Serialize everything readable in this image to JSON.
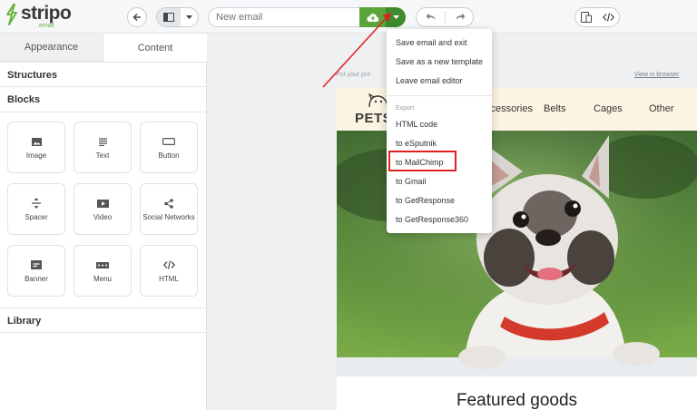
{
  "logo": {
    "word": "stripo",
    "sub": ".email"
  },
  "toolbar": {
    "email_name_placeholder": "New email",
    "icons": [
      "back-arrow-icon",
      "layout-icon",
      "caret-down-icon",
      "cloud-upload-icon",
      "undo-icon",
      "redo-icon",
      "mobile-view-icon",
      "code-icon"
    ]
  },
  "left_panel": {
    "tabs": [
      "Appearance",
      "Content"
    ],
    "active_tab": "Content",
    "sections": {
      "structures": "Structures",
      "blocks": "Blocks",
      "library": "Library"
    },
    "blocks": [
      {
        "label": "Image",
        "icon": "image-icon"
      },
      {
        "label": "Text",
        "icon": "text-icon"
      },
      {
        "label": "Button",
        "icon": "button-icon"
      },
      {
        "label": "Spacer",
        "icon": "spacer-icon"
      },
      {
        "label": "Video",
        "icon": "video-icon"
      },
      {
        "label": "Social Networks",
        "icon": "share-icon"
      },
      {
        "label": "Banner",
        "icon": "banner-icon"
      },
      {
        "label": "Menu",
        "icon": "menu-icon"
      },
      {
        "label": "HTML",
        "icon": "code-icon"
      }
    ]
  },
  "canvas": {
    "preheader": "Put your pre",
    "view_in_browser": "View in browser",
    "brand": "PETS",
    "nav": [
      "ccessories",
      "Belts",
      "Cages",
      "Other"
    ],
    "featured_heading": "Featured goods"
  },
  "save_menu": {
    "items": [
      "Save email and exit",
      "Save as a new template",
      "Leave email editor"
    ],
    "export_header": "Export",
    "export_items": [
      "HTML code",
      "to eSputnik",
      "to MailChimp",
      "to Gmail",
      "to GetResponse",
      "to GetResponse360"
    ],
    "highlighted": "to MailChimp"
  },
  "colors": {
    "accent_green": "#5aa53b",
    "dark_green": "#3f8a2d",
    "annotation_red": "#e02020",
    "nav_bg": "#fdf4e3"
  }
}
